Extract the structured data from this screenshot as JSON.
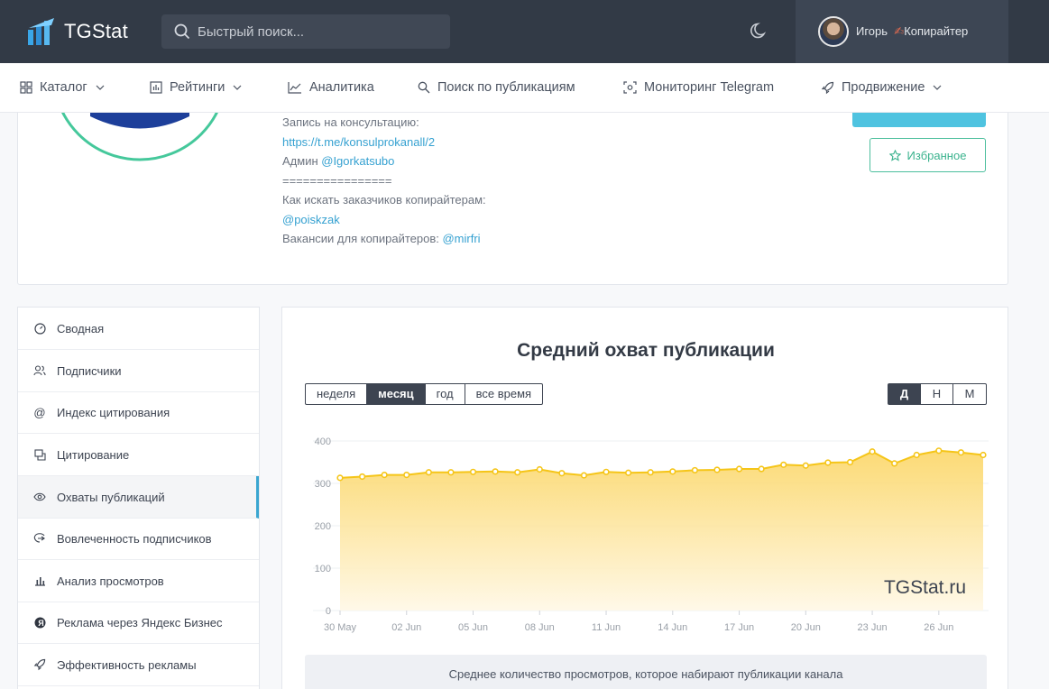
{
  "header": {
    "logo_text": "TGStat",
    "search_placeholder": "Быстрый поиск...",
    "user_name": "Игорь",
    "user_role": "Копирайтер"
  },
  "nav": [
    {
      "label": "Каталог",
      "icon": "grid-icon",
      "dropdown": true
    },
    {
      "label": "Рейтинги",
      "icon": "bar-chart-icon",
      "dropdown": true
    },
    {
      "label": "Аналитика",
      "icon": "line-chart-icon",
      "dropdown": false
    },
    {
      "label": "Поиск по публикациям",
      "icon": "search-icon",
      "dropdown": false
    },
    {
      "label": "Мониторинг Telegram",
      "icon": "monitor-icon",
      "dropdown": false
    },
    {
      "label": "Продвижение",
      "icon": "rocket-icon",
      "dropdown": true
    }
  ],
  "description": {
    "line1": "Запись на консультацию:",
    "link1": "https://t.me/konsulprokanall/2",
    "admin_label": "Админ ",
    "admin_handle": "@Igorkatsubo",
    "divider": "================",
    "line2": "Как искать заказчиков копирайтерам:",
    "link2": "@poiskzak",
    "vacancies_label": "Вакансии для копирайтеров: ",
    "vacancies_handle": "@mirfri"
  },
  "favorite_label": "Избранное",
  "sidebar": [
    {
      "label": "Сводная",
      "icon": "dashboard-icon"
    },
    {
      "label": "Подписчики",
      "icon": "users-icon"
    },
    {
      "label": "Индекс цитирования",
      "icon": "at-icon"
    },
    {
      "label": "Цитирование",
      "icon": "quote-icon"
    },
    {
      "label": "Охваты публикаций",
      "icon": "eye-icon",
      "active": true
    },
    {
      "label": "Вовлеченность подписчиков",
      "icon": "engagement-icon"
    },
    {
      "label": "Анализ просмотров",
      "icon": "bar-chart-icon"
    },
    {
      "label": "Реклама через Яндекс Бизнес",
      "icon": "yandex-icon"
    },
    {
      "label": "Эффективность рекламы",
      "icon": "rocket-icon"
    }
  ],
  "chart_controls": {
    "periods": [
      "неделя",
      "месяц",
      "год",
      "все время"
    ],
    "period_selected": "месяц",
    "units": [
      "Д",
      "Н",
      "М"
    ],
    "unit_selected": "Д"
  },
  "caption": "Среднее количество просмотров, которое набирают публикации канала",
  "watermark": "TGStat.ru",
  "colors": {
    "line": "#f5c518",
    "fill_top": "#fbd45e",
    "fill_bottom": "#fff8e6",
    "accent": "#3aa6d1",
    "fav": "#3bb38e"
  },
  "chart_data": {
    "type": "area",
    "title": "Средний охват публикации",
    "xlabel": "",
    "ylabel": "",
    "ylim": [
      0,
      400
    ],
    "yticks": [
      0,
      100,
      200,
      300,
      400
    ],
    "xtick_labels": [
      "30 May",
      "02 Jun",
      "05 Jun",
      "08 Jun",
      "11 Jun",
      "14 Jun",
      "17 Jun",
      "20 Jun",
      "23 Jun",
      "26 Jun"
    ],
    "x": [
      "30 May",
      "31 May",
      "01 Jun",
      "02 Jun",
      "03 Jun",
      "04 Jun",
      "05 Jun",
      "06 Jun",
      "07 Jun",
      "08 Jun",
      "09 Jun",
      "10 Jun",
      "11 Jun",
      "12 Jun",
      "13 Jun",
      "14 Jun",
      "15 Jun",
      "16 Jun",
      "17 Jun",
      "18 Jun",
      "19 Jun",
      "20 Jun",
      "21 Jun",
      "22 Jun",
      "23 Jun",
      "24 Jun",
      "25 Jun",
      "26 Jun",
      "27 Jun",
      "28 Jun"
    ],
    "values": [
      313,
      316,
      320,
      320,
      326,
      326,
      327,
      328,
      326,
      333,
      324,
      319,
      327,
      325,
      326,
      328,
      331,
      332,
      334,
      334,
      344,
      342,
      349,
      350,
      375,
      347,
      367,
      377,
      373,
      367
    ],
    "grid": true,
    "legend": "none"
  }
}
